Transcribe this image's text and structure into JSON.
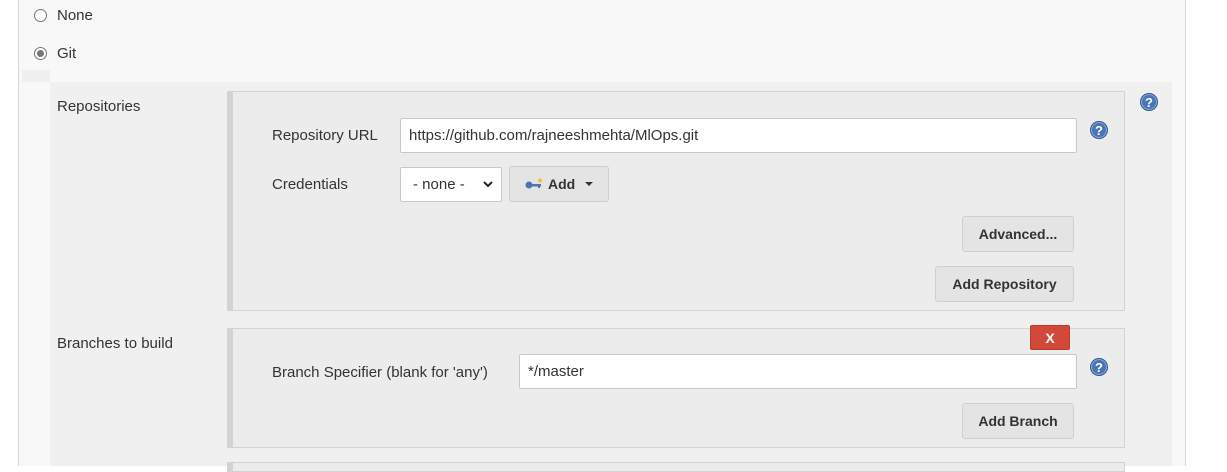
{
  "scm": {
    "options": [
      {
        "label": "None",
        "selected": false
      },
      {
        "label": "Git",
        "selected": true
      }
    ]
  },
  "repositories": {
    "label": "Repositories",
    "url_label": "Repository URL",
    "url_value": "https://github.com/rajneeshmehta/MlOps.git",
    "credentials_label": "Credentials",
    "credentials_selected": "- none -",
    "add_label": "Add",
    "advanced_label": "Advanced...",
    "add_repository_label": "Add Repository"
  },
  "branches": {
    "label": "Branches to build",
    "delete_label": "X",
    "specifier_label": "Branch Specifier (blank for 'any')",
    "specifier_value": "*/master",
    "add_branch_label": "Add Branch"
  },
  "help_glyph": "?",
  "colors": {
    "help_blue": "#4a74b4",
    "delete_red": "#d24939",
    "panel_bg": "#ececec"
  }
}
